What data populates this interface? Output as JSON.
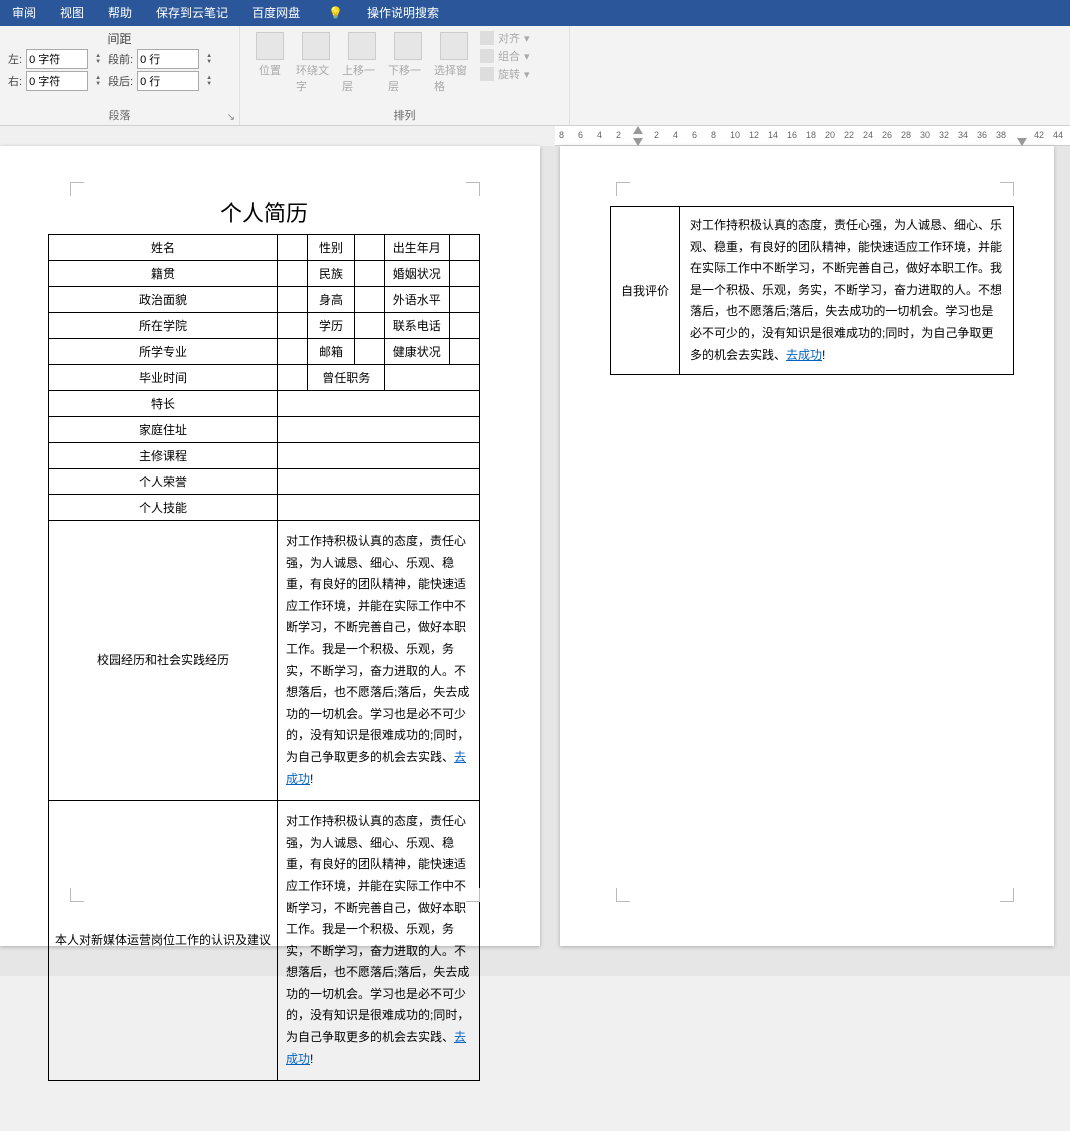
{
  "menubar": {
    "items": [
      "审阅",
      "视图",
      "帮助",
      "保存到云笔记",
      "百度网盘"
    ],
    "tell_me": "操作说明搜索"
  },
  "ribbon": {
    "spacing_title": "间距",
    "indent": {
      "left_label": "左:",
      "left_value": "0 字符",
      "right_label": "右:",
      "right_value": "0 字符",
      "before_label": "段前:",
      "before_value": "0 行",
      "after_label": "段后:",
      "after_value": "0 行"
    },
    "paragraph_group": "段落",
    "arrange": {
      "position": "位置",
      "wrap": "环绕文字",
      "bring_forward": "上移一层",
      "send_backward": "下移一层",
      "selection_pane": "选择窗格",
      "align": "对齐",
      "group": "组合",
      "rotate": "旋转"
    },
    "arrange_group": "排列"
  },
  "ruler_ticks": [
    "8",
    "6",
    "4",
    "2",
    "",
    "2",
    "4",
    "6",
    "8",
    "10",
    "12",
    "14",
    "16",
    "18",
    "20",
    "22",
    "24",
    "26",
    "28",
    "30",
    "32",
    "34",
    "36",
    "38",
    "",
    "42",
    "44"
  ],
  "doc": {
    "title": "个人简历",
    "rows": [
      [
        "姓名",
        "",
        "性别",
        "",
        "出生年月",
        ""
      ],
      [
        "籍贯",
        "",
        "民族",
        "",
        "婚姻状况",
        ""
      ],
      [
        "政治面貌",
        "",
        "身高",
        "",
        "外语水平",
        ""
      ],
      [
        "所在学院",
        "",
        "学历",
        "",
        "联系电话",
        ""
      ],
      [
        "所学专业",
        "",
        "邮箱",
        "",
        "健康状况",
        ""
      ]
    ],
    "grad_row": {
      "c1": "毕业时间",
      "c2": "",
      "c3": "曾任职务",
      "c4": ""
    },
    "full_rows": [
      "特长",
      "家庭住址",
      "主修课程",
      "个人荣誉",
      "个人技能"
    ],
    "long_sections": [
      {
        "label": "校园经历和社会实践经历"
      },
      {
        "label": "本人对新媒体运营岗位工作的认识及建议"
      }
    ],
    "paragraph": "对工作持积极认真的态度，责任心强，为人诚恳、细心、乐观、稳重，有良好的团队精神，能快速适应工作环境，并能在实际工作中不断学习，不断完善自己，做好本职工作。我是一个积极、乐观，务实，不断学习，奋力进取的人。不想落后，也不愿落后;落后，失去成功的一切机会。学习也是必不可少的，没有知识是很难成功的;同时，为自己争取更多的机会去实践、",
    "link_text": "去成功",
    "bang": "!"
  },
  "page2": {
    "label": "自我评价"
  }
}
